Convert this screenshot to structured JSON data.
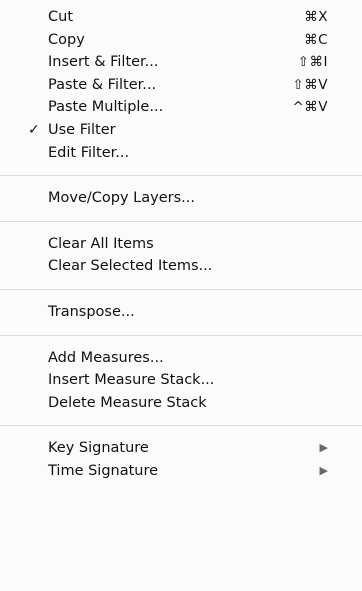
{
  "menu": {
    "groups": [
      {
        "items": [
          {
            "label": "Cut",
            "shortcut": "⌘X"
          },
          {
            "label": "Copy",
            "shortcut": "⌘C"
          },
          {
            "label": "Insert & Filter...",
            "shortcut": "⇧⌘I"
          },
          {
            "label": "Paste & Filter...",
            "shortcut": "⇧⌘V"
          },
          {
            "label": "Paste Multiple...",
            "shortcut": "^⌘V"
          },
          {
            "label": "Use Filter",
            "check": "✓"
          },
          {
            "label": "Edit Filter..."
          }
        ]
      },
      {
        "items": [
          {
            "label": "Move/Copy Layers..."
          }
        ]
      },
      {
        "items": [
          {
            "label": "Clear All Items"
          },
          {
            "label": "Clear Selected Items..."
          }
        ]
      },
      {
        "items": [
          {
            "label": "Transpose..."
          }
        ]
      },
      {
        "items": [
          {
            "label": "Add Measures..."
          },
          {
            "label": "Insert Measure Stack..."
          },
          {
            "label": "Delete Measure Stack"
          }
        ]
      },
      {
        "items": [
          {
            "label": "Key Signature",
            "arrow": "▶"
          },
          {
            "label": "Time Signature",
            "arrow": "▶"
          }
        ]
      }
    ]
  }
}
